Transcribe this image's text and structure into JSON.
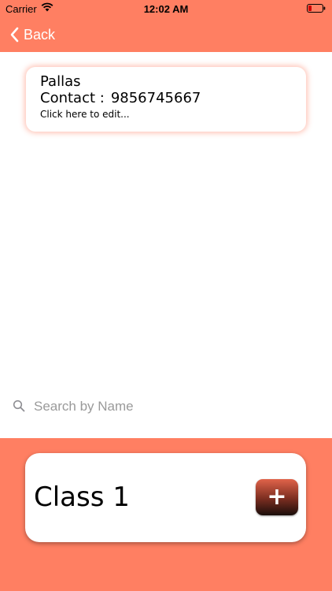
{
  "status_bar": {
    "carrier": "Carrier",
    "time": "12:02 AM"
  },
  "nav": {
    "back_label": "Back"
  },
  "contact_card": {
    "name": "Pallas",
    "contact_label": "Contact :",
    "contact_number": "9856745667",
    "hint": "Click here to edit..."
  },
  "search": {
    "placeholder": "Search by Name",
    "value": ""
  },
  "class_card": {
    "title": "Class 1",
    "add_label": "+"
  },
  "colors": {
    "accent": "#FF7F62",
    "background": "#FFFFFF"
  }
}
